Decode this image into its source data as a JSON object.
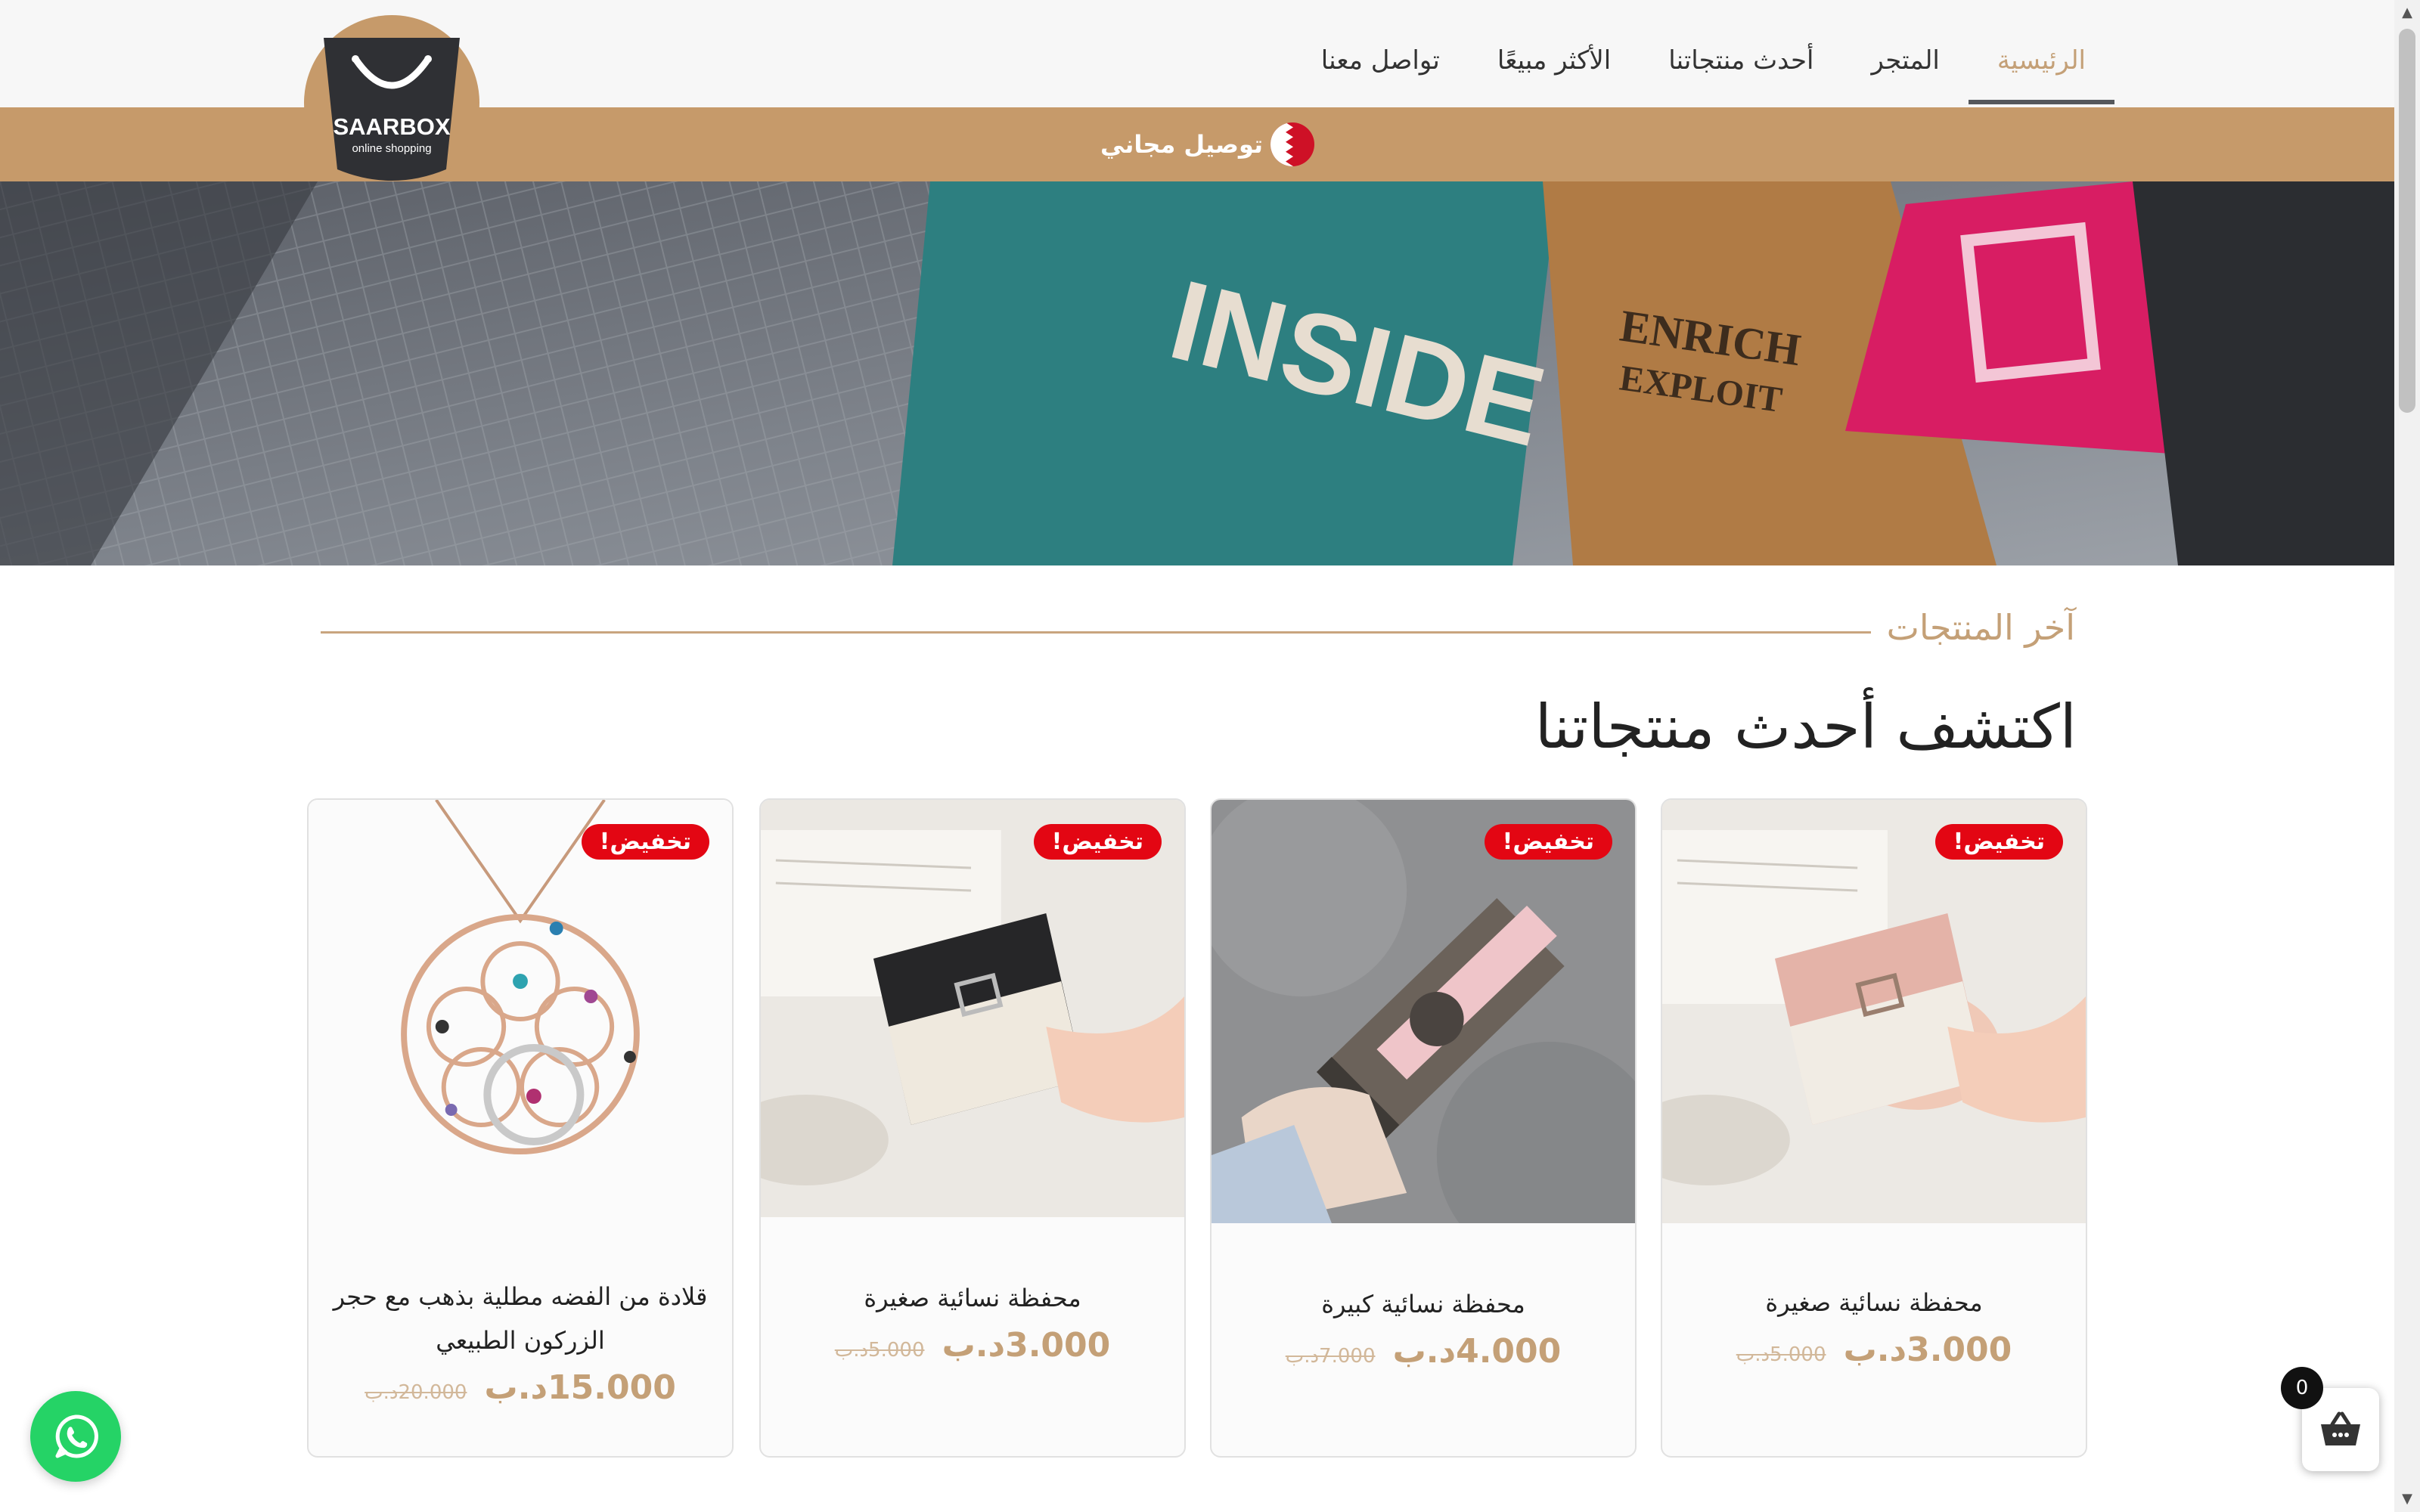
{
  "header": {
    "nav": [
      {
        "label": "الرئيسية",
        "active": true
      },
      {
        "label": "المتجر",
        "active": false
      },
      {
        "label": "أحدث منتجاتنا",
        "active": false
      },
      {
        "label": "الأكثر مبيعًا",
        "active": false
      },
      {
        "label": "تواصل معنا",
        "active": false
      }
    ],
    "logo": {
      "name": "SAARBOX",
      "tagline": "online shopping"
    },
    "ribbon_text": "توصيل مجاني",
    "flag_icon": "bahrain-flag-icon"
  },
  "hero": {
    "image_text": [
      "INSIDE",
      "ENRICH",
      "EXPLOIT"
    ]
  },
  "section": {
    "subtitle": "آخر المنتجات",
    "title": "اكتشف أحدث منتجاتنا"
  },
  "products": [
    {
      "badge": "تخفيض!",
      "name": "محفظة نسائية صغيرة",
      "price_now": "3.000د.ب",
      "price_old": "5.000د.ب",
      "image": "pink-wallet"
    },
    {
      "badge": "تخفيض!",
      "name": "محفظة نسائية كبيرة",
      "price_now": "4.000د.ب",
      "price_old": "7.000د.ب",
      "image": "monogram-wallet"
    },
    {
      "badge": "تخفيض!",
      "name": "محفظة نسائية صغيرة",
      "price_now": "3.000د.ب",
      "price_old": "5.000د.ب",
      "image": "black-wallet"
    },
    {
      "badge": "تخفيض!",
      "name": "قلادة من الفضه مطلية بذهب مع حجر الزركون الطبيعي",
      "price_now": "15.000د.ب",
      "price_old": "20.000د.ب",
      "image": "flower-necklace"
    }
  ],
  "cart": {
    "count": "0",
    "icon": "basket-icon"
  },
  "whatsapp": {
    "icon": "whatsapp-icon"
  },
  "colors": {
    "accent": "#c4a077",
    "ribbon": "#c69a6a",
    "sale": "#e30613",
    "whatsapp": "#25d366",
    "logo_dark": "#2f3034"
  }
}
